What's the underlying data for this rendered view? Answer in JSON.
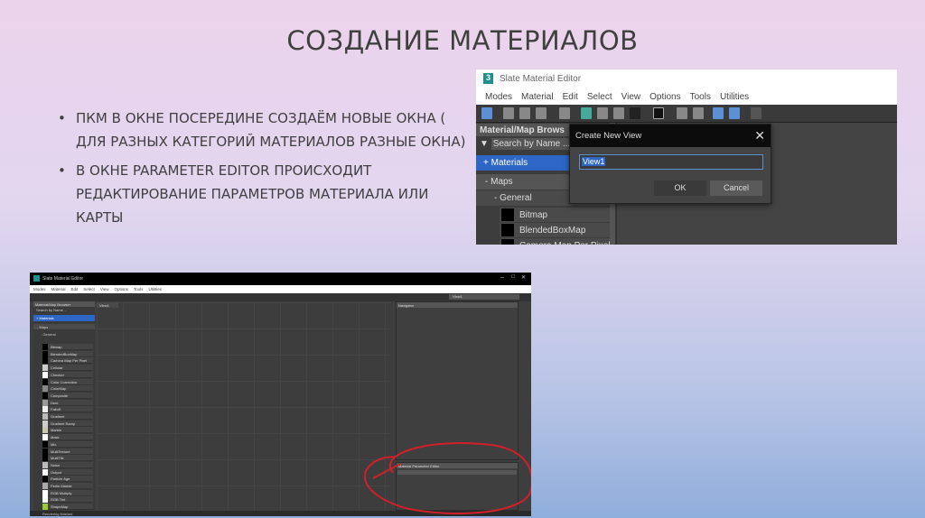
{
  "slide": {
    "title": "СОЗДАНИЕ МАТЕРИАЛОВ",
    "bullets": [
      "ПКМ В ОКНЕ ПОСЕРЕДИНЕ СОЗДАЁМ НОВЫЕ ОКНА ( ДЛЯ РАЗНЫХ КАТЕГОРИЙ МАТЕРИАЛОВ РАЗНЫЕ ОКНА)",
      "В ОКНЕ PARAMETER EDITOR ПРОИСХОДИТ РЕДАКТИРОВАНИЕ ПАРАМЕТРОВ МАТЕРИАЛА ИЛИ КАРТЫ"
    ]
  },
  "editor": {
    "app_title": "Slate Material Editor",
    "logo": "3",
    "menu": [
      "Modes",
      "Material",
      "Edit",
      "Select",
      "View",
      "Options",
      "Tools",
      "Utilities"
    ],
    "browser_title": "Material/Map Browser",
    "browser_title_short": "Material/Map Brows",
    "search_placeholder": "Search by Name ...",
    "materials": "+ Materials",
    "maps": "- Maps",
    "general": "- General",
    "dialog": {
      "title": "Create New View",
      "value": "View1",
      "ok": "OK",
      "cancel": "Cancel"
    },
    "view_tab": "View1",
    "view_select": "View1",
    "navigator": "Navigator",
    "param_editor": "Material Parameter Editor",
    "status": "Rendering finished",
    "maps_list": [
      {
        "name": "Bitmap",
        "swatch": "#000000"
      },
      {
        "name": "BlendedBoxMap",
        "swatch": "#000000"
      },
      {
        "name": "Camera Map Per Pixel",
        "swatch": "#000000"
      },
      {
        "name": "Cellular",
        "swatch": "#cccccc"
      },
      {
        "name": "Checker",
        "swatch": "#ffffff"
      },
      {
        "name": "Color Correction",
        "swatch": "#000000"
      },
      {
        "name": "ColorMap",
        "swatch": "#888888"
      },
      {
        "name": "Composite",
        "swatch": "#000000"
      },
      {
        "name": "Dent",
        "swatch": "#999999"
      },
      {
        "name": "Falloff",
        "swatch": "#eeeeee"
      },
      {
        "name": "Gradient",
        "swatch": "#bbbbbb"
      },
      {
        "name": "Gradient Ramp",
        "swatch": "#cccccc"
      },
      {
        "name": "Marble",
        "swatch": "#c8c8b0"
      },
      {
        "name": "Mask",
        "swatch": "#ffffff"
      },
      {
        "name": "Mix",
        "swatch": "#000000"
      },
      {
        "name": "MultiTexture",
        "swatch": "#000000"
      },
      {
        "name": "MultiTile",
        "swatch": "#000000"
      },
      {
        "name": "Noise",
        "swatch": "#bbbbbb"
      },
      {
        "name": "Output",
        "swatch": "#ffffff"
      },
      {
        "name": "Particle Age",
        "swatch": "#000000"
      },
      {
        "name": "Perlin Marble",
        "swatch": "#aaaaaa"
      },
      {
        "name": "RGB Multiply",
        "swatch": "#ffffff"
      },
      {
        "name": "RGB Tint",
        "swatch": "#ffffff"
      },
      {
        "name": "ShapeMap",
        "swatch": "#9acd32"
      }
    ]
  },
  "colors": {
    "selection": "#2e66c5",
    "annotation": "#d0202a"
  }
}
